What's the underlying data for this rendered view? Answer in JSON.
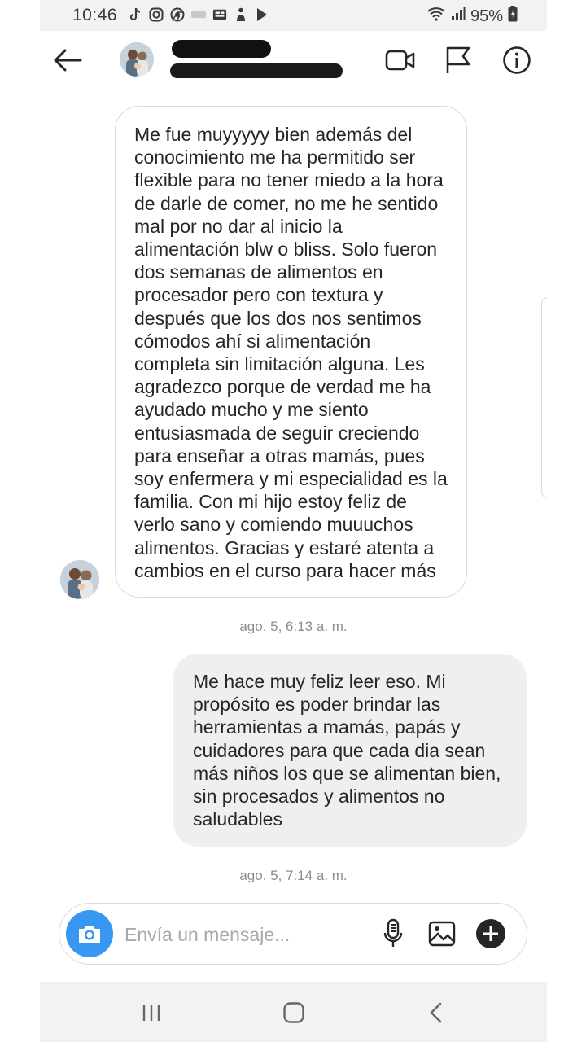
{
  "status_bar": {
    "time": "10:46",
    "battery": "95%",
    "icons": [
      "tiktok-icon",
      "instagram-icon",
      "chrome-icon",
      "app-icon",
      "news-icon",
      "figure-icon",
      "play-icon"
    ]
  },
  "header": {
    "contact_name": "",
    "contact_subtitle": "",
    "icons": [
      "back-arrow-icon",
      "video-call-icon",
      "flag-icon",
      "info-icon"
    ]
  },
  "messages": [
    {
      "direction": "incoming",
      "text": "Me fue muyyyyy bien además del conocimiento me ha permitido ser flexible para no tener miedo a la hora de darle de comer, no me he sentido mal por no dar al inicio la alimentación blw o bliss. Solo fueron dos semanas de alimentos en procesador pero con textura y después que los dos nos sentimos cómodos ahí si alimentación completa sin limitación alguna. Les agradezco porque de verdad me ha ayudado mucho y me siento entusiasmada de seguir creciendo para enseñar a otras mamás, pues soy enfermera y mi especialidad es la familia. Con mi hijo estoy feliz de verlo sano y comiendo muuuchos alimentos. Gracias y estaré atenta a cambios en el curso para hacer más",
      "timestamp": "ago. 5, 6:13 a. m."
    },
    {
      "direction": "outgoing",
      "text": "Me hace muy feliz leer eso. Mi propósito es poder brindar las herramientas a mamás, papás y cuidadores para que cada dia sean más niños los que se alimentan bien, sin procesados y alimentos no saludables",
      "timestamp": "ago. 5, 7:14 a. m."
    }
  ],
  "composer": {
    "placeholder": "Envía un mensaje...",
    "value": "",
    "icons": [
      "camera-icon",
      "microphone-icon",
      "gallery-icon",
      "add-icon"
    ]
  },
  "nav_bar": {
    "icons": [
      "recents-icon",
      "home-icon",
      "back-icon"
    ]
  },
  "colors": {
    "accent": "#3897f0",
    "outgoing_bubble": "#efefef",
    "bar_background": "#f2f2f2",
    "text": "#262626",
    "timestamp": "#8e8e8e"
  }
}
